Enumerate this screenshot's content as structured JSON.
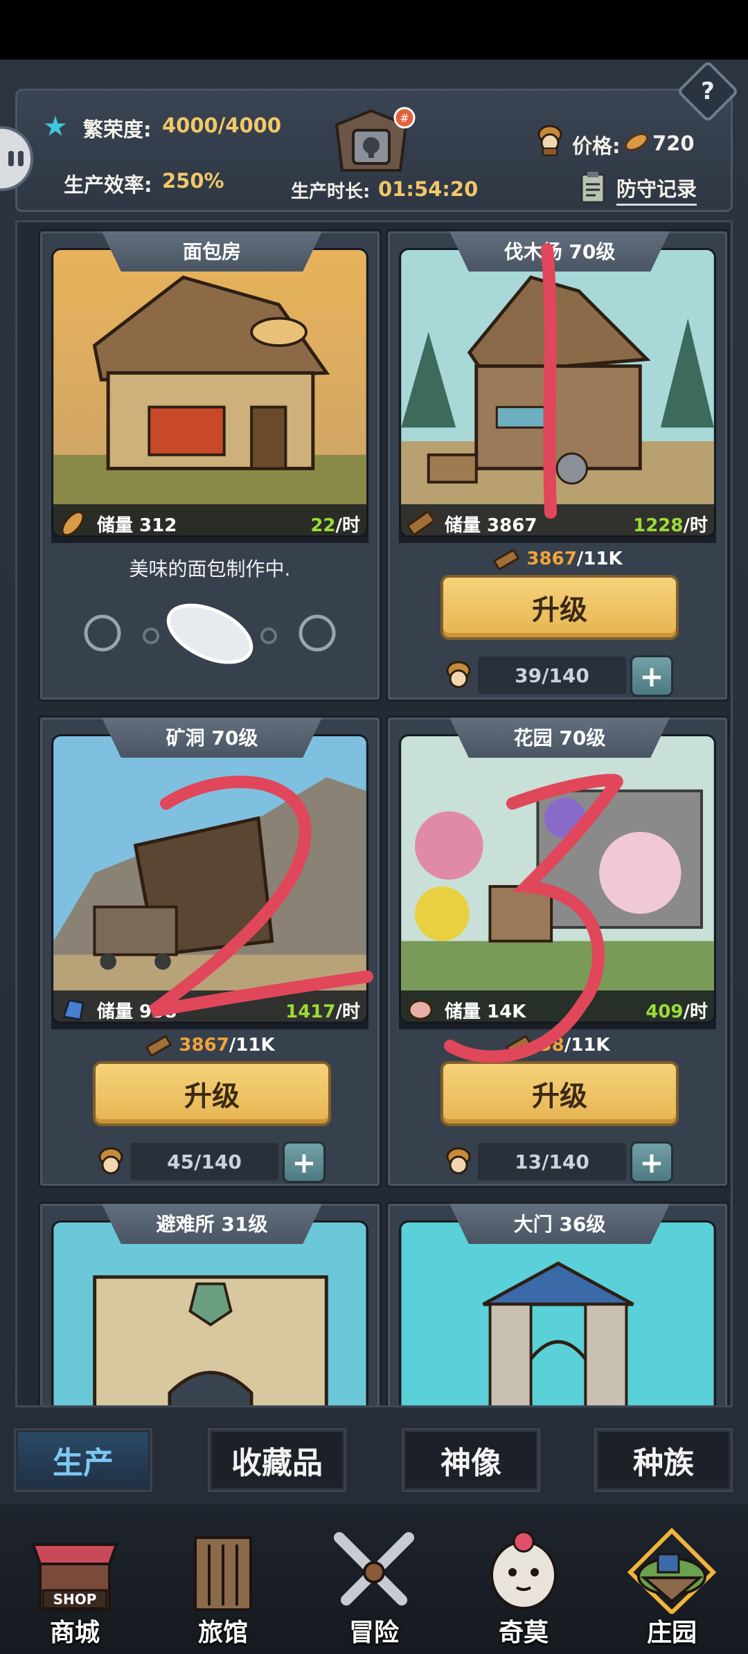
{
  "header": {
    "prosperity_label": "繁荣度:",
    "prosperity_value": "4000/4000",
    "efficiency_label": "生产效率:",
    "efficiency_value": "250%",
    "duration_label": "生产时长:",
    "duration_value": "01:54:20",
    "price_label": "价格:",
    "price_value": "720",
    "defense_record": "防守记录",
    "help": "?"
  },
  "buildings": [
    {
      "name": "面包房",
      "storage": "储量 312",
      "rate": "22",
      "unit": "/时",
      "status": "美味的面包制作中."
    },
    {
      "name": "伐木场 70级",
      "storage": "储量 3867",
      "rate": "1228",
      "unit": "/时",
      "cost_current": "3867",
      "cost_total": "/11K",
      "upgrade": "升级",
      "workers": "39/140",
      "plus": "+"
    },
    {
      "name": "矿洞 70级",
      "storage": "储量 938",
      "rate": "1417",
      "unit": "/时",
      "cost_current": "3867",
      "cost_total": "/11K",
      "upgrade": "升级",
      "workers": "45/140",
      "plus": "+"
    },
    {
      "name": "花园 70级",
      "storage": "储量 14K",
      "rate": "409",
      "unit": "/时",
      "cost_current": "38",
      "cost_total": "/11K",
      "upgrade": "升级",
      "workers": "13/140",
      "plus": "+"
    },
    {
      "name": "避难所 31级"
    },
    {
      "name": "大门 36级"
    }
  ],
  "tabs": [
    "生产",
    "收藏品",
    "神像",
    "种族"
  ],
  "nav": [
    {
      "label": "商城",
      "icon": "shop-icon",
      "sign": "SHOP"
    },
    {
      "label": "旅馆",
      "icon": "inn-gate-icon"
    },
    {
      "label": "冒险",
      "icon": "crossed-swords-icon"
    },
    {
      "label": "奇莫",
      "icon": "creature-icon"
    },
    {
      "label": "庄园",
      "icon": "floating-island-icon"
    }
  ],
  "colors": {
    "accent_gold": "#f2c869",
    "rate_green": "#9bdc37",
    "cost_orange": "#f2a33a",
    "annotation_red": "#e0475a"
  }
}
